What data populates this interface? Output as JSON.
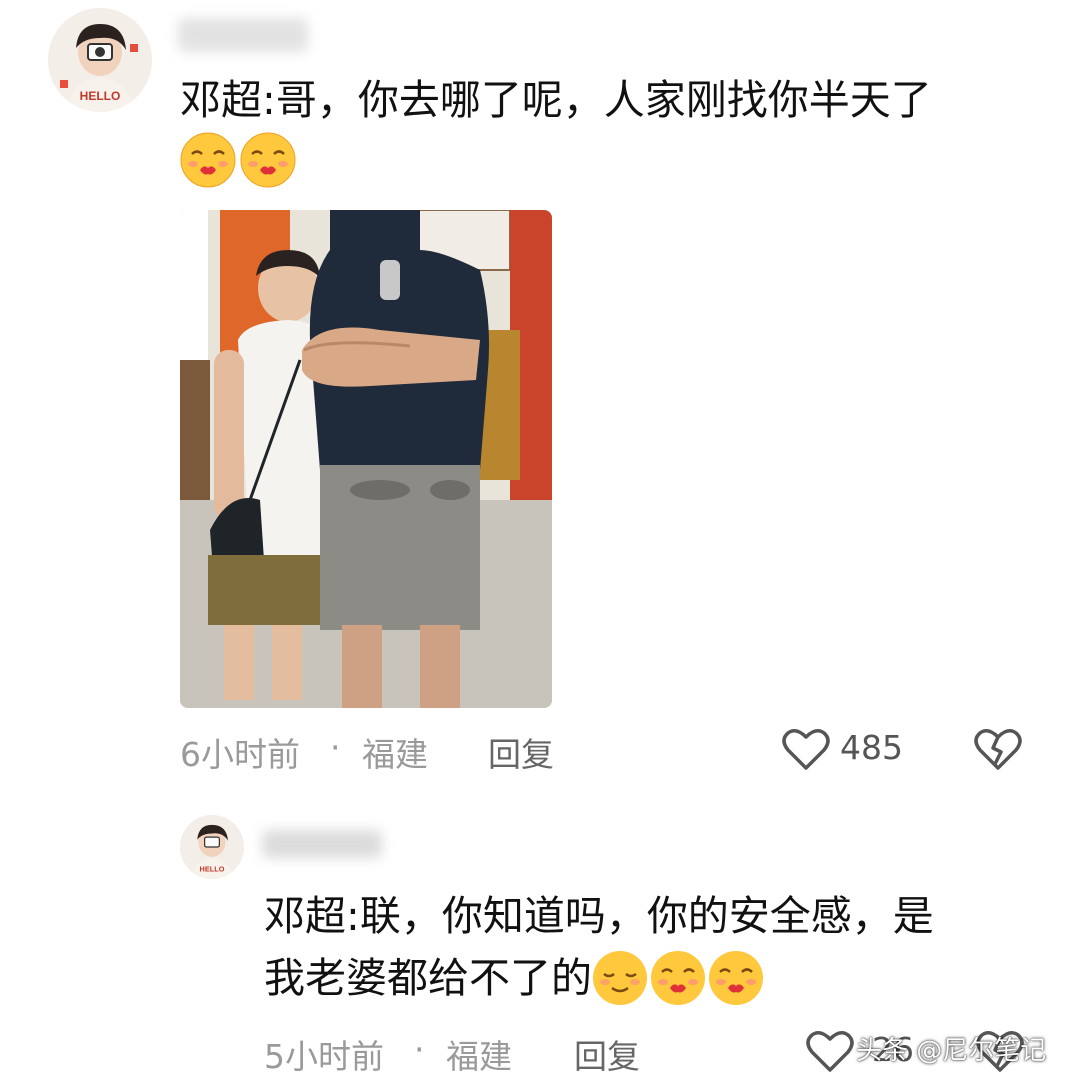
{
  "comment": {
    "username": "",
    "text": "邓超:哥，你去哪了呢，人家刚找你半天了",
    "emojis": [
      "kiss-emoji",
      "kiss-emoji"
    ],
    "time": "6小时前",
    "separator": "·",
    "location": "福建",
    "reply_label": "回复",
    "like_count": "485"
  },
  "reply": {
    "username": "",
    "text_line1": "邓超:联，你知道吗，你的安全感，是",
    "text_line2": "我老婆都给不了的",
    "emojis": [
      "smug-emoji",
      "kiss-emoji",
      "kiss-emoji"
    ],
    "time": "5小时前",
    "separator": "·",
    "location": "福建",
    "reply_label": "回复",
    "like_count": "26"
  },
  "watermark": "头条 @尼尔笔记",
  "colors": {
    "text": "#111111",
    "meta": "#9a9a9a",
    "emoji_yellow": "#ffc83d",
    "emoji_lips": "#e0303a"
  }
}
